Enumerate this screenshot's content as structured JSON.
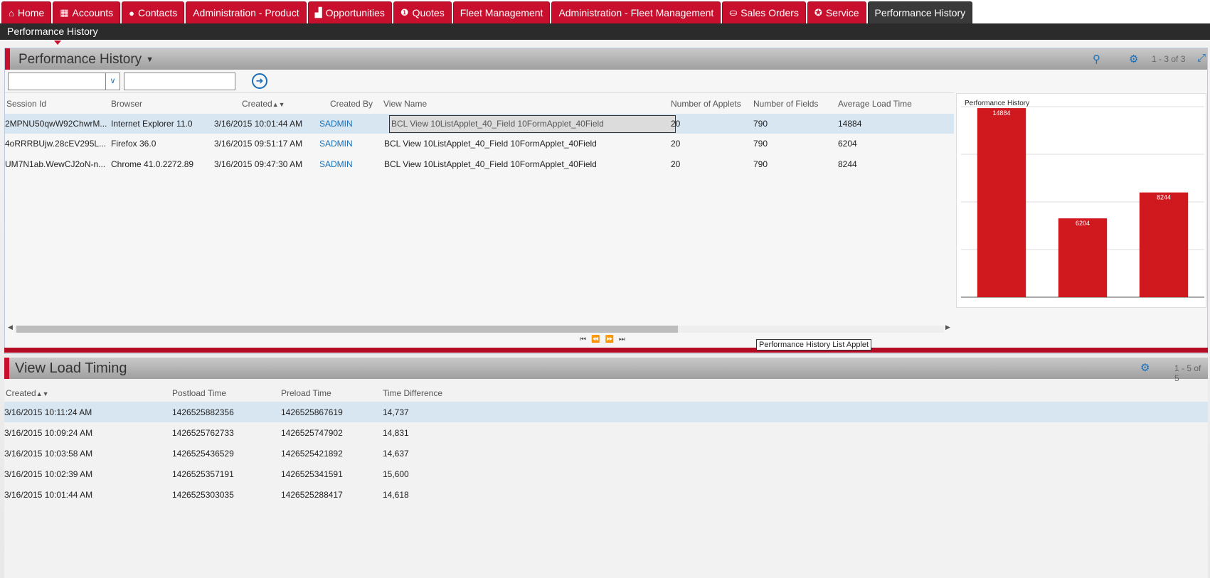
{
  "tabs": [
    {
      "label": "Home",
      "icon": "home-icon",
      "glyph": "⌂",
      "active": false
    },
    {
      "label": "Accounts",
      "icon": "building-icon",
      "glyph": "▦",
      "active": false
    },
    {
      "label": "Contacts",
      "icon": "person-icon",
      "glyph": "●",
      "active": false
    },
    {
      "label": "Administration - Product",
      "icon": "",
      "glyph": "",
      "active": false
    },
    {
      "label": "Opportunities",
      "icon": "bar-chart-icon",
      "glyph": "▟",
      "active": false
    },
    {
      "label": "Quotes",
      "icon": "quote-icon",
      "glyph": "❶",
      "active": false
    },
    {
      "label": "Fleet Management",
      "icon": "",
      "glyph": "",
      "active": false
    },
    {
      "label": "Administration - Fleet Management",
      "icon": "",
      "glyph": "",
      "active": false
    },
    {
      "label": "Sales Orders",
      "icon": "sales-orders-icon",
      "glyph": "⛀",
      "active": false
    },
    {
      "label": "Service",
      "icon": "service-icon",
      "glyph": "✪",
      "active": false
    },
    {
      "label": "Performance History",
      "icon": "",
      "glyph": "",
      "active": true
    }
  ],
  "subnav": {
    "label": "Performance History"
  },
  "applet1": {
    "title": "Performance History",
    "count": "1 - 3 of 3",
    "columns": [
      "Session Id",
      "Browser",
      "Created",
      "Created By",
      "View Name",
      "Number of Applets",
      "Number of Fields",
      "Average Load Time"
    ],
    "rows": [
      {
        "session": "2MPNU50qwW92ChwrM...",
        "browser": "Internet Explorer 11.0",
        "created": "3/16/2015 10:01:44 AM",
        "by": "SADMIN",
        "view": "BCL View 10ListApplet_40_Field 10FormApplet_40Field",
        "applets": "20",
        "fields": "790",
        "load": "14884"
      },
      {
        "session": "4oRRRBUjw.28cEV295L...",
        "browser": "Firefox 36.0",
        "created": "3/16/2015 09:51:17 AM",
        "by": "SADMIN",
        "view": "BCL View 10ListApplet_40_Field 10FormApplet_40Field",
        "applets": "20",
        "fields": "790",
        "load": "6204"
      },
      {
        "session": "UM7N1ab.WewCJ2oN-n...",
        "browser": "Chrome 41.0.2272.89",
        "created": "3/16/2015 09:47:30 AM",
        "by": "SADMIN",
        "view": "BCL View 10ListApplet_40_Field 10FormApplet_40Field",
        "applets": "20",
        "fields": "790",
        "load": "8244"
      }
    ],
    "tooltip": "Performance History List Applet"
  },
  "chart_data": {
    "type": "bar",
    "title": "Performance History",
    "categories": [
      "",
      "",
      ""
    ],
    "values": [
      14884,
      6204,
      8244
    ],
    "data_labels": [
      "14884",
      "6204",
      "8244"
    ],
    "ylim": [
      0,
      15000
    ],
    "grid": true,
    "color": "#d0181f"
  },
  "applet2": {
    "title": "View Load Timing",
    "count": "1 - 5 of 5",
    "columns": [
      "Created",
      "Postload Time",
      "Preload Time",
      "Time Difference"
    ],
    "rows": [
      {
        "created": "3/16/2015 10:11:24 AM",
        "post": "1426525882356",
        "pre": "1426525867619",
        "diff": "14,737"
      },
      {
        "created": "3/16/2015 10:09:24 AM",
        "post": "1426525762733",
        "pre": "1426525747902",
        "diff": "14,831"
      },
      {
        "created": "3/16/2015 10:03:58 AM",
        "post": "1426525436529",
        "pre": "1426525421892",
        "diff": "14,637"
      },
      {
        "created": "3/16/2015 10:02:39 AM",
        "post": "1426525357191",
        "pre": "1426525341591",
        "diff": "15,600"
      },
      {
        "created": "3/16/2015 10:01:44 AM",
        "post": "1426525303035",
        "pre": "1426525288417",
        "diff": "14,618"
      }
    ]
  }
}
